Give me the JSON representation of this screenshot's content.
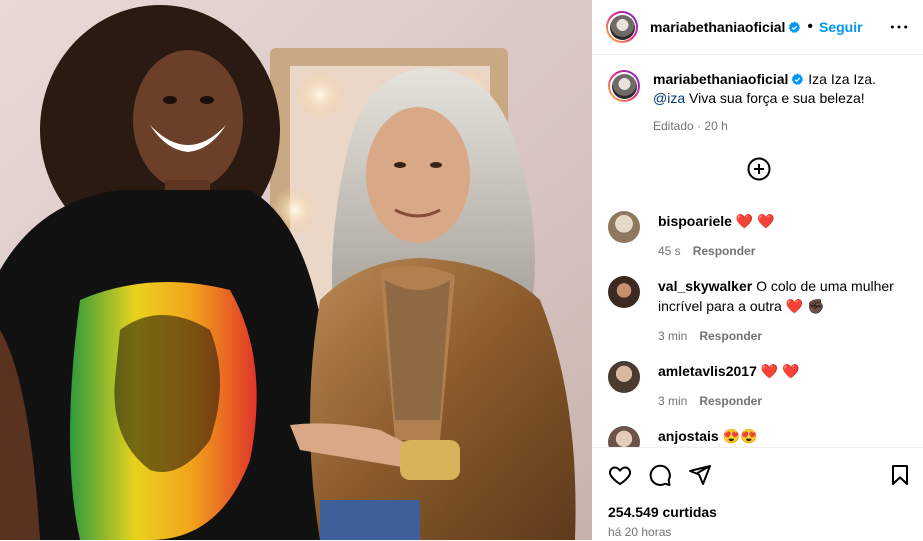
{
  "post": {
    "image_alt": "Foto de duas mulheres sorrindo em um camarim",
    "author": "mariabethaniaoficial",
    "follow_label": "Seguir",
    "separator": "•",
    "caption_text": "Iza Iza Iza.",
    "caption_mention": "@iza",
    "caption_rest": "Viva sua força e sua beleza!",
    "edited_label": "Editado",
    "edited_sep": "·",
    "edited_time": "20 h",
    "likes": "254.549 curtidas",
    "time_ago": "há 20 horas"
  },
  "comments": [
    {
      "user": "bispoariele",
      "text": "",
      "emoji": "❤️ ❤️",
      "time": "45 s",
      "reply": "Responder"
    },
    {
      "user": "val_skywalker",
      "text": "O colo de uma mulher incrível para a outra",
      "emoji": "❤️ ✊🏿",
      "time": "3 min",
      "reply": "Responder"
    },
    {
      "user": "amletavlis2017",
      "text": "",
      "emoji": "❤️ ❤️",
      "time": "3 min",
      "reply": "Responder"
    },
    {
      "user": "anjostais",
      "text": "",
      "emoji": "😍😍",
      "time": "",
      "reply": ""
    }
  ],
  "icons": {
    "like": "heart-icon",
    "comment": "comment-icon",
    "share": "share-icon",
    "save": "bookmark-icon",
    "more": "more-icon",
    "add": "plus-circle-icon",
    "verified": "verified-badge-icon"
  },
  "colors": {
    "accent": "#0095f6",
    "mention": "#00376b",
    "muted": "#737373",
    "verified": "#0095f6"
  }
}
